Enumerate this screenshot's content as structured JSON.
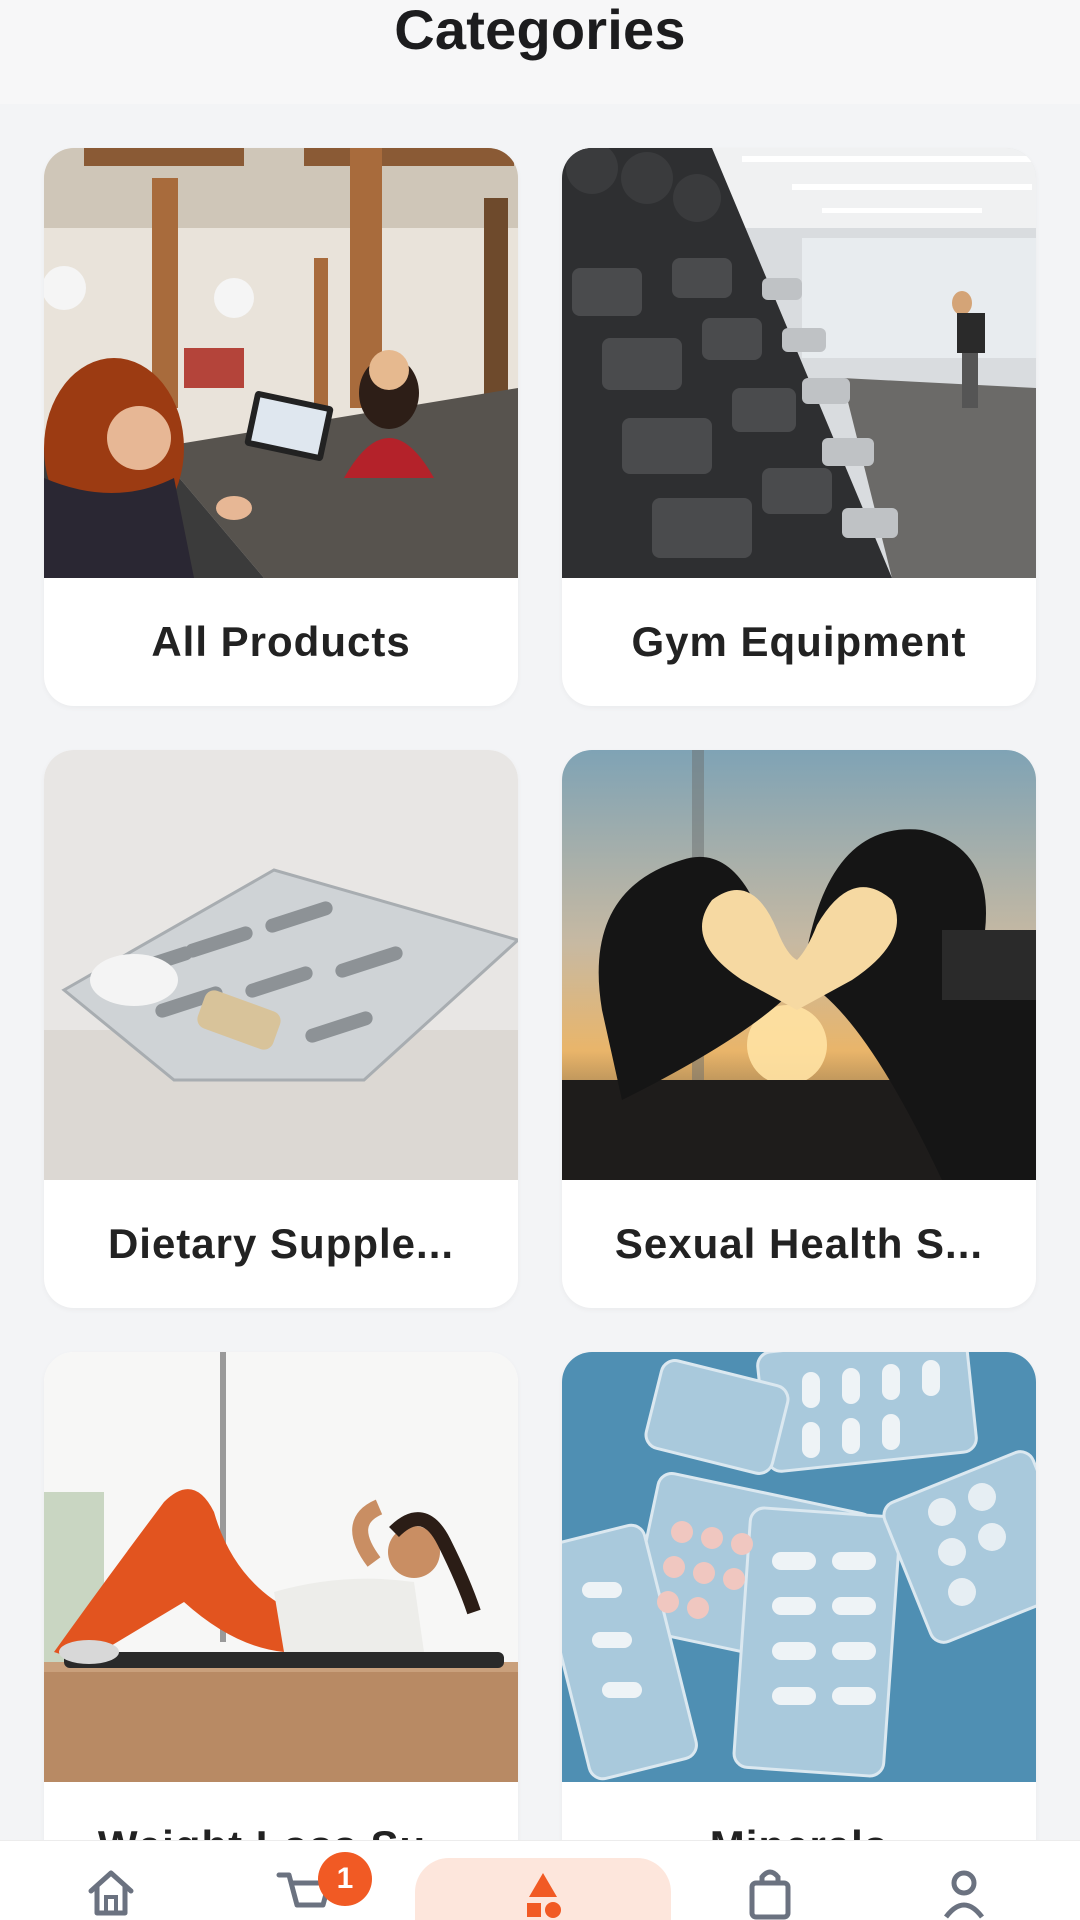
{
  "header": {
    "title": "Categories"
  },
  "categories": [
    {
      "label": "All Products",
      "image": "salon-checkout-photo"
    },
    {
      "label": "Gym Equipment",
      "image": "dumbbell-rack-photo"
    },
    {
      "label": "Dietary Supple...",
      "image": "blister-pack-photo"
    },
    {
      "label": "Sexual Health S...",
      "image": "heart-hands-sunset-photo"
    },
    {
      "label": "Weight Loss Su...",
      "image": "woman-crunches-photo"
    },
    {
      "label": "Minerals",
      "image": "pill-blisters-photo"
    }
  ],
  "bottom_nav": {
    "items": [
      "home-icon",
      "cart-icon",
      "categories-icon",
      "shopping-bag-icon",
      "profile-icon"
    ],
    "active": "categories-icon",
    "cart_badge": "1"
  },
  "colors": {
    "accent": "#f15a24",
    "active_bg": "#fde6dc",
    "background": "#f3f4f6"
  }
}
